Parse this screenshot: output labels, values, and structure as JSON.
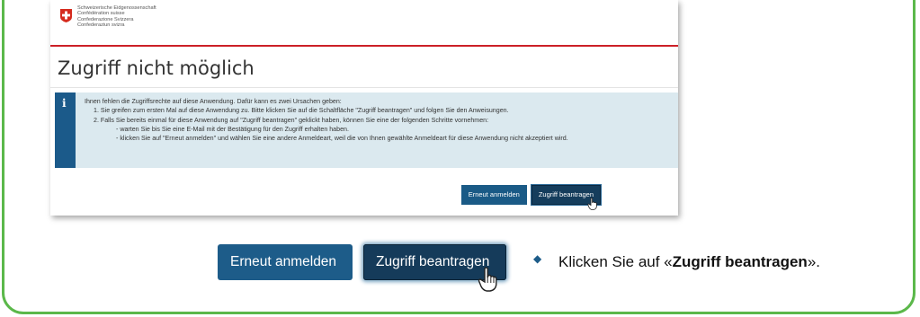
{
  "government": {
    "lines": [
      "Schweizerische Eidgenossenschaft",
      "Confédération suisse",
      "Confederazione Svizzera",
      "Confederaziun svizra"
    ]
  },
  "page": {
    "title": "Zugriff nicht möglich"
  },
  "info": {
    "icon": "i",
    "intro": "Ihnen fehlen die Zugriffsrechte auf diese Anwendung. Dafür kann es zwei Ursachen geben:",
    "item1": "1. Sie greifen zum ersten Mal auf diese Anwendung zu. Bitte klicken Sie auf die Schaltfläche \"Zugriff beantragen\" und folgen Sie den Anweisungen.",
    "item2": "2. Falls Sie bereits einmal für diese Anwendung auf \"Zugriff beantragen\" geklickt haben, können Sie eine der folgenden Schritte vornehmen:",
    "sub1": "- warten Sie bis Sie eine E-Mail mit der Bestätigung für den Zugriff erhalten haben.",
    "sub2": "- klicken Sie auf \"Erneut anmelden\" und wählen Sie eine andere Anmeldeart, weil die von Ihnen gewählte Anmeldeart für diese Anwendung nicht akzeptiert wird."
  },
  "buttons": {
    "relogin": "Erneut anmelden",
    "request": "Zugriff beantragen"
  },
  "instruction": {
    "prefix": "Klicken Sie auf «",
    "bold": "Zugriff beantragen",
    "suffix": "»."
  },
  "colors": {
    "frame": "#5bb84a",
    "primary": "#1d5c89",
    "infoBg": "#dbe9ef",
    "redline": "#cc2027"
  },
  "icons": {
    "flag": "swiss-cross-icon",
    "cursor": "hand-pointer-icon",
    "bullet": "diamond-bullet-icon"
  }
}
